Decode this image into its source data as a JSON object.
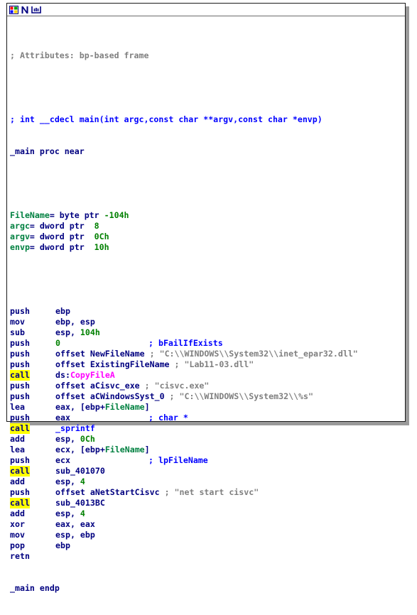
{
  "toolbar": {
    "buttons": [
      {
        "name": "graph-view-icon"
      },
      {
        "name": "font-n-icon"
      },
      {
        "name": "zoom-icon"
      }
    ]
  },
  "code": {
    "attributes_comment": "; Attributes: bp-based frame",
    "prototype": "; int __cdecl main(int argc,const char **argv,const char *envp)",
    "proc_line": "_main proc near",
    "vars": [
      {
        "name": "FileName",
        "decl": "= byte ptr -104h"
      },
      {
        "name": "argc",
        "decl": "= dword ptr  8"
      },
      {
        "name": "argv",
        "decl": "= dword ptr  0Ch"
      },
      {
        "name": "envp",
        "decl": "= dword ptr  10h"
      }
    ],
    "instructions": [
      {
        "mn": "push",
        "op": "ebp",
        "cm": "",
        "hl": false
      },
      {
        "mn": "mov",
        "op": "ebp, esp",
        "cm": "",
        "hl": false
      },
      {
        "mn": "sub",
        "op": "esp, 104h",
        "cm": "",
        "hl": false
      },
      {
        "mn": "push",
        "op": "0",
        "cm": "; bFailIfExists",
        "hl": false
      },
      {
        "mn": "push",
        "op": "offset NewFileName",
        "cm": "; \"C:\\\\WINDOWS\\\\System32\\\\inet_epar32.dll\"",
        "hl": false
      },
      {
        "mn": "push",
        "op": "offset ExistingFileName",
        "cm": "; \"Lab11-03.dll\"",
        "hl": false
      },
      {
        "mn": "call",
        "op": "ds:CopyFileA",
        "cm": "",
        "hl": true
      },
      {
        "mn": "push",
        "op": "offset aCisvc_exe",
        "cm": "; \"cisvc.exe\"",
        "hl": false
      },
      {
        "mn": "push",
        "op": "offset aCWindowsSyst_0",
        "cm": "; \"C:\\\\WINDOWS\\\\System32\\\\%s\"",
        "hl": false
      },
      {
        "mn": "lea",
        "op": "eax, [ebp+FileName]",
        "cm": "",
        "hl": false
      },
      {
        "mn": "push",
        "op": "eax",
        "cm": "; char *",
        "hl": false
      },
      {
        "mn": "call",
        "op": "_sprintf",
        "cm": "",
        "hl": true
      },
      {
        "mn": "add",
        "op": "esp, 0Ch",
        "cm": "",
        "hl": false
      },
      {
        "mn": "lea",
        "op": "ecx, [ebp+FileName]",
        "cm": "",
        "hl": false
      },
      {
        "mn": "push",
        "op": "ecx",
        "cm": "; lpFileName",
        "hl": false
      },
      {
        "mn": "call",
        "op": "sub_401070",
        "cm": "",
        "hl": true
      },
      {
        "mn": "add",
        "op": "esp, 4",
        "cm": "",
        "hl": false
      },
      {
        "mn": "push",
        "op": "offset aNetStartCisvc",
        "cm": "; \"net start cisvc\"",
        "hl": false
      },
      {
        "mn": "call",
        "op": "sub_4013BC",
        "cm": "",
        "hl": true
      },
      {
        "mn": "add",
        "op": "esp, 4",
        "cm": "",
        "hl": false
      },
      {
        "mn": "xor",
        "op": "eax, eax",
        "cm": "",
        "hl": false
      },
      {
        "mn": "mov",
        "op": "esp, ebp",
        "cm": "",
        "hl": false
      },
      {
        "mn": "pop",
        "op": "ebp",
        "cm": "",
        "hl": false
      },
      {
        "mn": "retn",
        "op": "",
        "cm": "",
        "hl": false
      }
    ],
    "endp_line": "_main endp"
  }
}
